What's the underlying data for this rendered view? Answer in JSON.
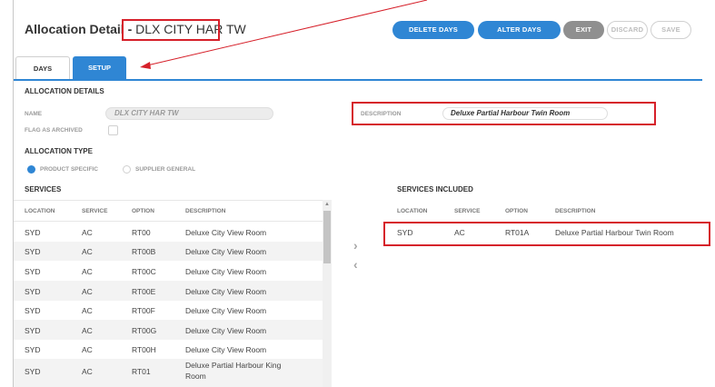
{
  "header": {
    "title": "Allocation Detail -",
    "code": "DLX CITY HAR TW"
  },
  "toolbar": {
    "delete_days": "DELETE DAYS",
    "alter_days": "ALTER DAYS",
    "exit": "EXIT",
    "discard": "DISCARD",
    "save": "SAVE"
  },
  "tabs": [
    {
      "label": "DAYS"
    },
    {
      "label": "SETUP"
    }
  ],
  "details": {
    "section_title": "ALLOCATION DETAILS",
    "name_label": "NAME",
    "name_value": "DLX CITY HAR TW",
    "description_label": "DESCRIPTION",
    "description_value": "Deluxe Partial Harbour Twin Room",
    "archived_label": "FLAG AS ARCHIVED"
  },
  "allocation_type": {
    "section_title": "ALLOCATION TYPE",
    "options": [
      {
        "label": "PRODUCT SPECIFIC",
        "selected": true
      },
      {
        "label": "SUPPLIER GENERAL",
        "selected": false
      }
    ]
  },
  "services": {
    "title": "SERVICES",
    "columns": [
      "LOCATION",
      "SERVICE",
      "OPTION",
      "DESCRIPTION"
    ],
    "rows": [
      [
        "SYD",
        "AC",
        "RT00",
        "Deluxe City View Room"
      ],
      [
        "SYD",
        "AC",
        "RT00B",
        "Deluxe City View Room"
      ],
      [
        "SYD",
        "AC",
        "RT00C",
        "Deluxe City View Room"
      ],
      [
        "SYD",
        "AC",
        "RT00E",
        "Deluxe City View Room"
      ],
      [
        "SYD",
        "AC",
        "RT00F",
        "Deluxe City View Room"
      ],
      [
        "SYD",
        "AC",
        "RT00G",
        "Deluxe City View Room"
      ],
      [
        "SYD",
        "AC",
        "RT00H",
        "Deluxe City View Room"
      ],
      [
        "SYD",
        "AC",
        "RT01",
        "Deluxe Partial Harbour King",
        "Room"
      ]
    ]
  },
  "services_included": {
    "title": "SERVICES INCLUDED",
    "columns": [
      "LOCATION",
      "SERVICE",
      "OPTION",
      "DESCRIPTION"
    ],
    "rows": [
      [
        "SYD",
        "AC",
        "RT01A",
        "Deluxe Partial Harbour Twin Room"
      ]
    ]
  },
  "colors": {
    "accent": "#2f86d4",
    "highlight": "#d6202a",
    "exit_button": "#8f8f8f"
  },
  "icons": [
    "chevron-right-icon",
    "chevron-left-icon",
    "radio-selected-icon",
    "radio-unselected-icon",
    "annotation-arrow"
  ]
}
